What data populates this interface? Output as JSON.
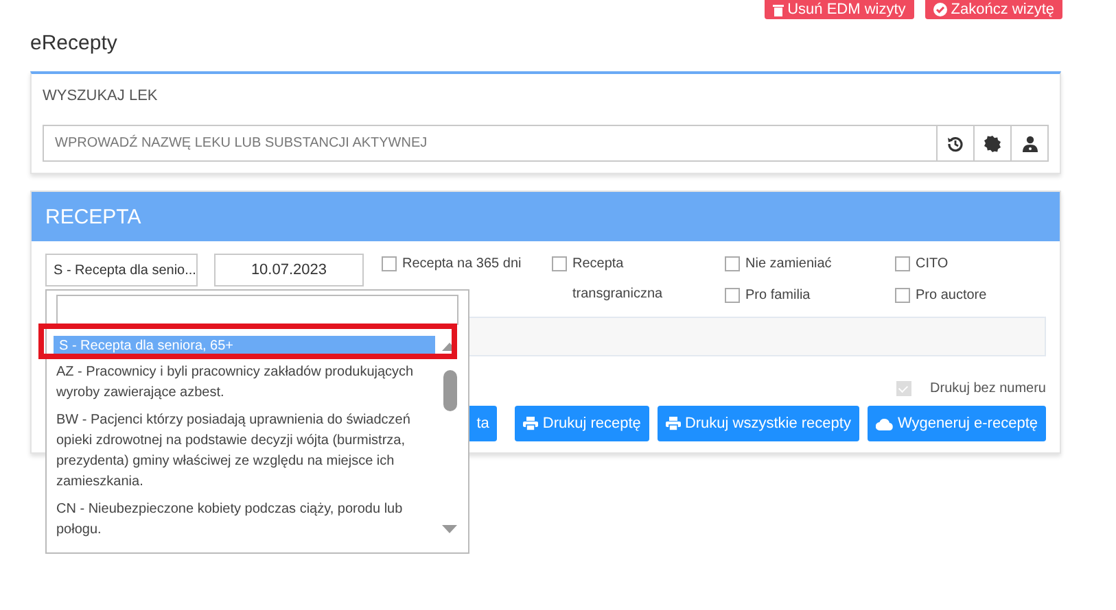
{
  "top_actions": [
    {
      "label": "Usuń EDM wizyty"
    },
    {
      "label": "Zakończ wizytę"
    }
  ],
  "page_title": "eRecepty",
  "search_card": {
    "title": "WYSZUKAJ LEK",
    "placeholder": "WPROWADŹ NAZWĘ LEKU LUB SUBSTANCJI AKTYWNEJ"
  },
  "recipe_card": {
    "title": "RECEPTA",
    "code_select": "S - Recepta dla senio...",
    "date": "10.07.2023",
    "options": [
      {
        "label": "Recepta na 365 dni",
        "checked": false
      },
      {
        "label": "Recepta transgraniczna",
        "checked": false
      },
      {
        "label": "Nie zamieniać",
        "checked": false
      },
      {
        "label": "Pro familia",
        "checked": false
      },
      {
        "label": "CITO",
        "checked": false
      },
      {
        "label": "Pro auctore",
        "checked": false
      }
    ],
    "print_without_number": {
      "label": "Drukuj bez numeru",
      "checked": true,
      "disabled": true
    },
    "buttons": [
      {
        "label": "ta"
      },
      {
        "label": "Drukuj receptę"
      },
      {
        "label": "Drukuj wszystkie recepty"
      },
      {
        "label": "Wygeneruj e-receptę"
      }
    ]
  },
  "dropdown": {
    "items": [
      {
        "text": "S - Recepta dla seniora, 65+",
        "selected": true
      },
      {
        "text": "AZ - Pracownicy i byli pracownicy zakładów produkujących wyroby zawierające azbest.",
        "selected": false
      },
      {
        "text": "BW - Pacjenci którzy posiadają uprawnienia do świadczeń opieki zdrowotnej na podstawie decyzji wójta (burmistrza, prezydenta) gminy właściwej ze względu na miejsce ich zamieszkania.",
        "selected": false
      },
      {
        "text": "CN - Nieubezpieczone kobiety podczas ciąży, porodu lub połogu.",
        "selected": false
      }
    ]
  }
}
